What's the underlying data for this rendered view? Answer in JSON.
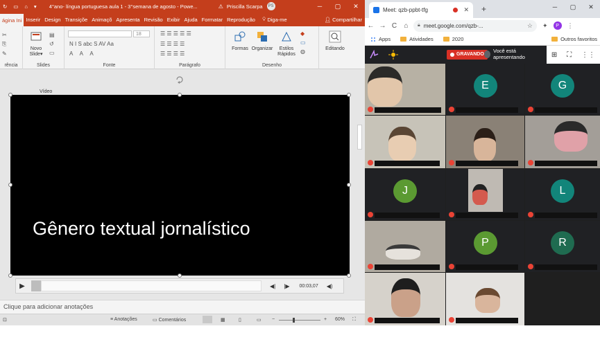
{
  "powerpoint": {
    "quick_access": [
      "↻",
      "▭",
      "⌂",
      "▾"
    ],
    "window_title": "4°ano- língua portuguesa aula 1 - 3°semana de agosto  -  Powe...",
    "warning_icon": "warning-icon",
    "user_name": "Priscilla Scarpa",
    "user_initials": "PS",
    "window_buttons": [
      "─",
      "▢",
      "✕"
    ],
    "tabs": [
      "ágina Ini",
      "Inserir",
      "Design",
      "Transiçõe",
      "Animaçõ",
      "Apresenta",
      "Revisão",
      "Exibir",
      "Ajuda",
      "Formatar",
      "Reprodução"
    ],
    "tell_me": "Diga-me",
    "share": "Compartilhar",
    "ribbon": {
      "new_slide": "Novo Slide",
      "new_slide_suffix": "▾",
      "shapes": "Formas",
      "arrange": "Organizar",
      "quick_styles": "Estilos Rápidos",
      "editing": "Editando",
      "font_size": "18",
      "groups": {
        "clipboard": "rência",
        "slides": "Slides",
        "font": "Fonte",
        "paragraph": "Parágrafo",
        "drawing": "Desenho"
      },
      "font_icons": "N I S abc S AV Aa",
      "font_icons2": "A A A",
      "para_icons": "☰ ☰ ☰ ☰ ☰",
      "para_icons2": "☰ ☰ ☰ ☰"
    },
    "video_label": "Vídeo",
    "slide_text": "Gênero textual jornalístico",
    "player": {
      "play": "▶",
      "back": "◀|",
      "forward": "|▶",
      "time": "00:03,07",
      "volume": "◀)"
    },
    "notes_placeholder": "Clique para adicionar anotações",
    "status": {
      "notes": "Anotações",
      "comments": "Comentários",
      "zoom_minus": "−",
      "zoom_plus": "+",
      "zoom": "60%",
      "zoom_fraction": 0.33
    }
  },
  "chrome": {
    "tab_title": "Meet: qzb-ppbt-tfg",
    "tab_close": "✕",
    "new_tab": "+",
    "window_buttons": [
      "─",
      "▢",
      "✕"
    ],
    "nav": [
      "←",
      "→",
      "C",
      "⌂"
    ],
    "url": "meet.google.com/qzb-...",
    "profile_initial": "P",
    "bookmarks": [
      "Apps",
      "Atividades",
      "2020",
      "Outros favoritos"
    ],
    "menu": "⋮",
    "extensions": "✦"
  },
  "meet": {
    "recording": "GRAVANDO",
    "presenting": "Você está apresentando",
    "tools": [
      "⊞",
      "⛶",
      "⋮⋮"
    ],
    "initials": [
      "E",
      "G",
      "J",
      "L",
      "P",
      "R"
    ],
    "colors": {
      "E": "#12857a",
      "G": "#12857a",
      "J": "#5b9a32",
      "L": "#12857a",
      "P": "#5b9a32",
      "R": "#1f6b50"
    }
  }
}
